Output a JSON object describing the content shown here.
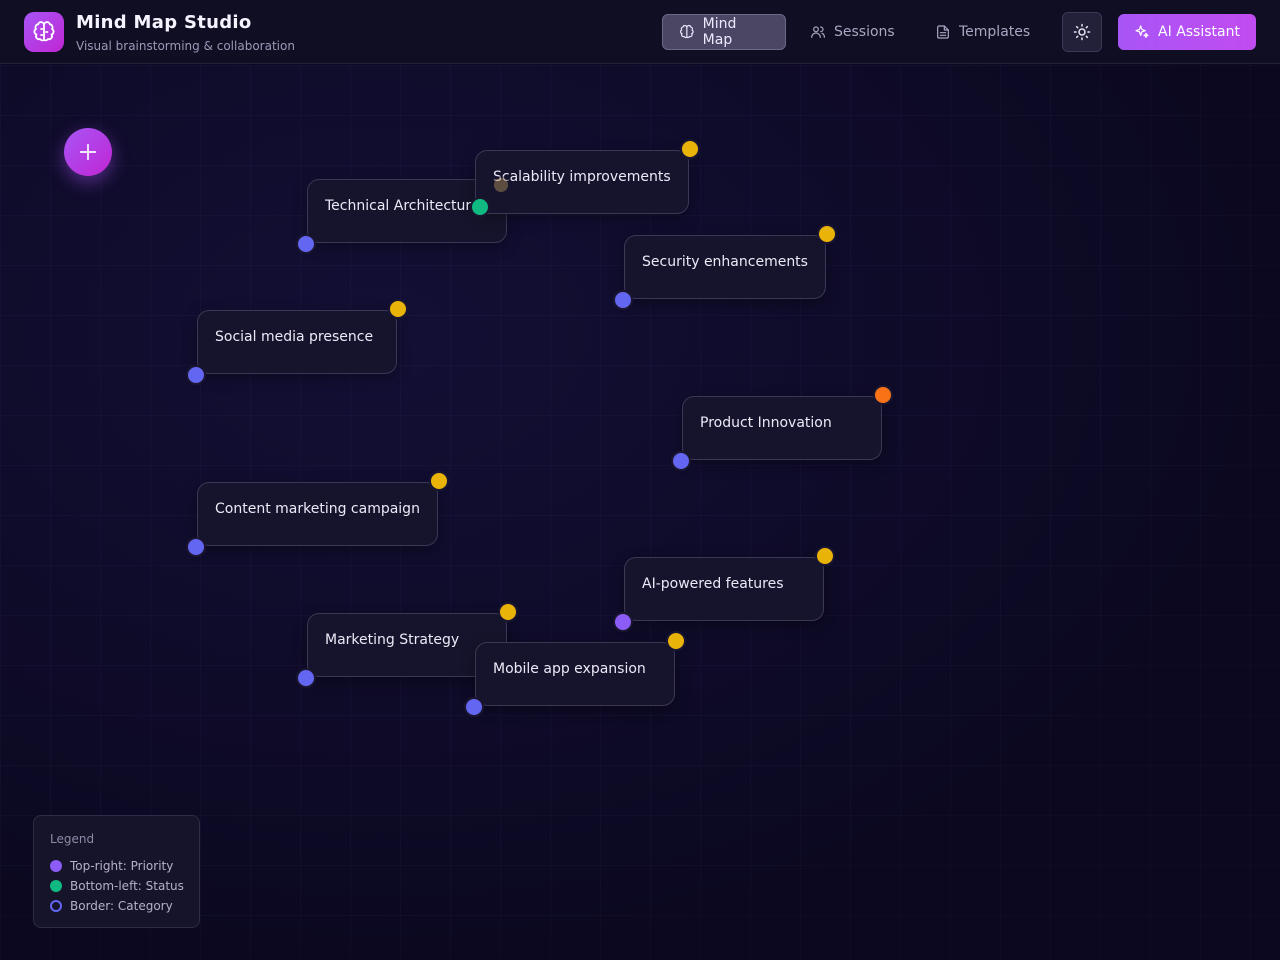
{
  "header": {
    "title": "Mind Map Studio",
    "subtitle": "Visual brainstorming & collaboration",
    "nav": [
      {
        "label": "Mind Map",
        "icon": "brain-icon",
        "active": true
      },
      {
        "label": "Sessions",
        "icon": "users-icon",
        "active": false
      },
      {
        "label": "Templates",
        "icon": "document-icon",
        "active": false
      }
    ],
    "theme_toggle_icon": "sun-icon",
    "ai_button_label": "AI Assistant"
  },
  "colors": {
    "accent": "#a855f7",
    "priority_high": "#f97316",
    "priority_medium": "#eab308",
    "category_blue": "#6366f1",
    "category_purple": "#8b5cf6",
    "status_done": "#10b981"
  },
  "nodes": [
    {
      "label": "Technical Architecture",
      "priority_color": "#10b981",
      "status_color": "#6366f1"
    },
    {
      "label": "Scalability improvements",
      "priority_color": "#eab308",
      "status_color": "#b4925a"
    },
    {
      "label": "Security enhancements",
      "priority_color": "#eab308",
      "status_color": "#6366f1"
    },
    {
      "label": "Social media presence",
      "priority_color": "#eab308",
      "status_color": "#6366f1"
    },
    {
      "label": "Product Innovation",
      "priority_color": "#f97316",
      "status_color": "#6366f1"
    },
    {
      "label": "Content marketing campaign",
      "priority_color": "#eab308",
      "status_color": "#6366f1"
    },
    {
      "label": "AI-powered features",
      "priority_color": "#eab308",
      "status_color": "#8b5cf6"
    },
    {
      "label": "Marketing Strategy",
      "priority_color": "#eab308",
      "status_color": "#6366f1"
    },
    {
      "label": "Mobile app expansion",
      "priority_color": "#eab308",
      "status_color": "#6366f1"
    }
  ],
  "legend": {
    "title": "Legend",
    "items": [
      {
        "label": "Top-right: Priority",
        "color": "#8b5cf6"
      },
      {
        "label": "Bottom-left: Status",
        "color": "#10b981"
      },
      {
        "label": "Border: Category",
        "color": "#6366f1"
      }
    ]
  }
}
